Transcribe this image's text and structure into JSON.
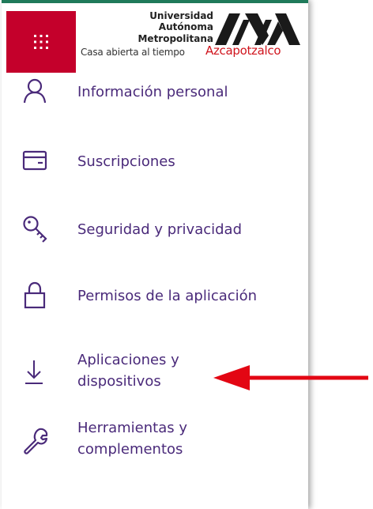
{
  "colors": {
    "waffle_bg": "#c4002b",
    "link_text": "#4a2a7a",
    "icon_stroke": "#4a2a7a",
    "annotation_arrow": "#e30613",
    "logo_campus": "#d0141d"
  },
  "header": {
    "app_launcher_icon": "waffle-icon",
    "logo": {
      "line1": "Universidad",
      "line2": "Autónoma",
      "line3": "Metropolitana",
      "tagline": "Casa abierta al tiempo",
      "campus": "Azcapotzalco"
    }
  },
  "menu": {
    "items": [
      {
        "label": "Información personal",
        "icon": "person-icon"
      },
      {
        "label": "Suscripciones",
        "icon": "credit-card-icon"
      },
      {
        "label": "Seguridad y privacidad",
        "icon": "key-icon"
      },
      {
        "label": "Permisos de la aplicación",
        "icon": "lock-icon"
      },
      {
        "label_line1": "Aplicaciones y",
        "label_line2": "dispositivos",
        "icon": "download-icon"
      },
      {
        "label_line1": "Herramientas y",
        "label_line2": "complementos",
        "icon": "wrench-icon"
      }
    ]
  },
  "annotation": {
    "icon": "red-arrow-icon"
  }
}
